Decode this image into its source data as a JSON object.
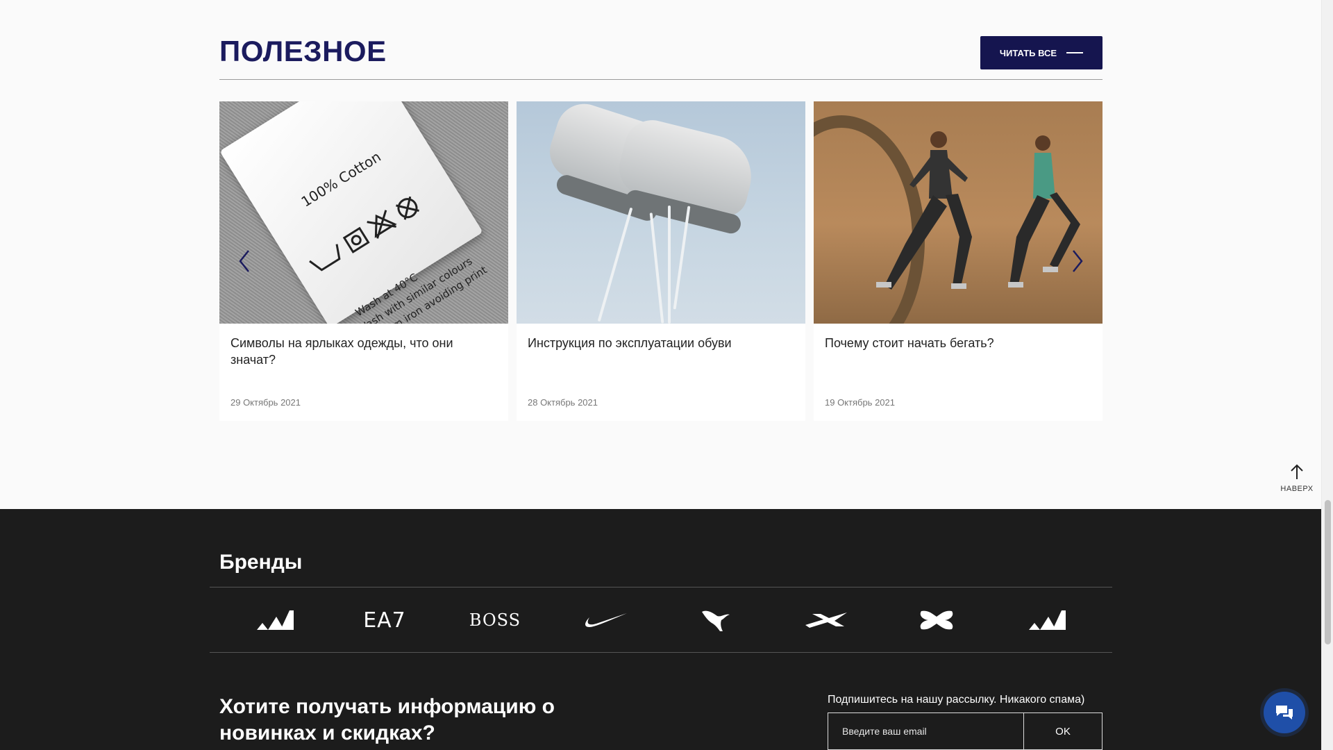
{
  "useful": {
    "title": "ПОЛЕЗНОЕ",
    "read_all_label": "ЧИТАТЬ ВСЕ",
    "articles": [
      {
        "title": "Символы на ярлыках одежды, что они значат?",
        "date": "29 Октябрь 2021",
        "image_text": "100% Cotton"
      },
      {
        "title": "Инструкция по эксплуатации обуви",
        "date": "28 Октябрь 2021"
      },
      {
        "title": "Почему стоит начать бегать?",
        "date": "19 Октябрь 2021"
      }
    ]
  },
  "to_top": {
    "label": "НАВЕРХ"
  },
  "footer": {
    "brands_title": "Бренды",
    "brands": [
      {
        "name": "adidas",
        "icon": "adidas-logo"
      },
      {
        "name": "EA7",
        "icon": "ea7-logo"
      },
      {
        "name": "BOSS",
        "icon": "boss-logo"
      },
      {
        "name": "Nike",
        "icon": "nike-logo"
      },
      {
        "name": "Puma",
        "icon": "puma-logo"
      },
      {
        "name": "Reebok",
        "icon": "reebok-logo"
      },
      {
        "name": "Under Armour",
        "icon": "under-armour-logo"
      },
      {
        "name": "adidas",
        "icon": "adidas-logo"
      }
    ],
    "newsletter_title": "Хотите получать информацию о новинках и скидках?",
    "subscribe_label": "Подпишитесь на нашу рассылку. Никакого спама)",
    "email_placeholder": "Введите ваш email",
    "ok_label": "OK"
  },
  "colors": {
    "accent": "#15154f",
    "footer_bg": "#1c1c1c",
    "chat": "#1f4fa8"
  }
}
